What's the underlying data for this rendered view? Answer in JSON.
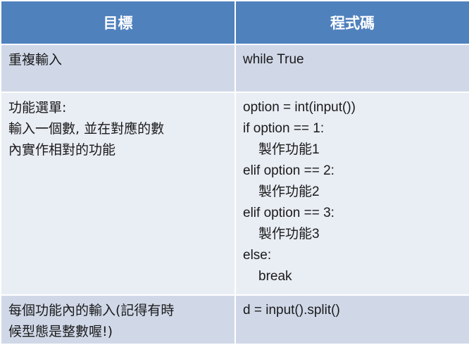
{
  "header": {
    "goal": "目標",
    "code": "程式碼"
  },
  "rows": [
    {
      "goal_lines": [
        "重複輸入"
      ],
      "code_lines": [
        "while True"
      ]
    },
    {
      "goal_lines": [
        "功能選單:",
        "輸入一個數, 並在對應的數",
        "內實作相對的功能"
      ],
      "code_lines": [
        "option = int(input())",
        "if option == 1:",
        "製作功能1",
        "elif option == 2:",
        "製作功能2",
        "elif option == 3:",
        "製作功能3",
        "else:",
        "break"
      ]
    },
    {
      "goal_lines": [
        "每個功能內的輸入(記得有時",
        "候型態是整數喔!)"
      ],
      "code_lines": [
        "d = input().split()"
      ]
    }
  ]
}
